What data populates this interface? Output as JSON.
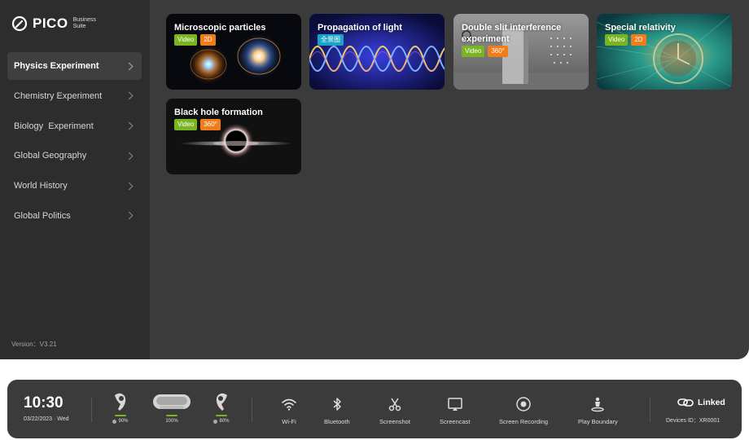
{
  "brand": {
    "name": "PICO",
    "sub_line1": "Business",
    "sub_line2": "Suite"
  },
  "sidebar": {
    "items": [
      {
        "label": "Physics Experiment",
        "active": true
      },
      {
        "label": "Chemistry Experiment",
        "active": false
      },
      {
        "label": "Biology  Experiment",
        "active": false
      },
      {
        "label": "Global Geography",
        "active": false
      },
      {
        "label": "World History",
        "active": false
      },
      {
        "label": "Global Politics",
        "active": false
      }
    ],
    "version": "Version：V3.21"
  },
  "cards": [
    {
      "title": "Microscopic particles",
      "tags": [
        "Video",
        "2D"
      ]
    },
    {
      "title": "Propagation of light",
      "tags": [
        "全景图"
      ]
    },
    {
      "title": "Double slit interference experiment",
      "tags": [
        "Video",
        "360°"
      ]
    },
    {
      "title": "Special relativity",
      "tags": [
        "Video",
        "2D"
      ]
    },
    {
      "title": "Black hole formation",
      "tags": [
        "Video",
        "360°"
      ]
    }
  ],
  "status": {
    "time": "10:30",
    "date": "03/22/2023 · Wed",
    "controller_left_battery": "90%",
    "headset_battery": "100%",
    "controller_right_battery": "80%"
  },
  "quick_actions": {
    "wifi": "Wi-Fi",
    "bluetooth": "Bluetooth",
    "screenshot": "Screenshot",
    "screencast": "Screencast",
    "screen_recording": "Screen Recording",
    "play_boundary": "Play Boundary"
  },
  "link": {
    "status": "Linked",
    "device_id": "Devices ID：XR0001"
  },
  "colors": {
    "tag_video": "#7bb421",
    "tag_orange": "#f07d1a",
    "tag_cyan": "#1aa3c8",
    "active_item": "#3f3f3f"
  }
}
